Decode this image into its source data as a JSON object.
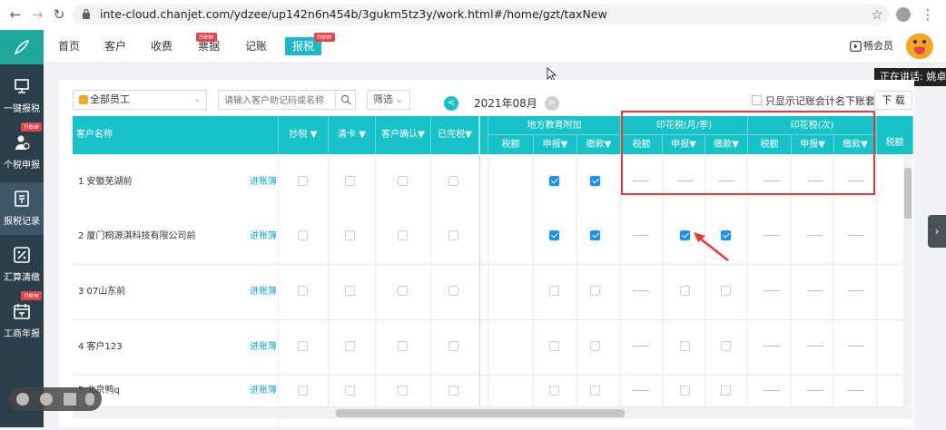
{
  "browser": {
    "url": "inte-cloud.chanjet.com/ydzee/up142n6n454b/3gukm5tz3y/work.html#/home/gzt/taxNew"
  },
  "sidebar": {
    "items": [
      {
        "label": "一键报税",
        "icon": "monitor-icon",
        "new": ""
      },
      {
        "label": "个税申报",
        "icon": "user-tax-icon",
        "new": "new"
      },
      {
        "label": "报税记录",
        "icon": "tax-record-icon",
        "new": ""
      },
      {
        "label": "汇算清缴",
        "icon": "percent-icon",
        "new": ""
      },
      {
        "label": "工商年报",
        "icon": "calendar-icon",
        "new": "new"
      }
    ]
  },
  "topnav": {
    "items": [
      {
        "label": "首页"
      },
      {
        "label": "客户"
      },
      {
        "label": "收费"
      },
      {
        "label": "票据",
        "new": "new"
      },
      {
        "label": "记账"
      },
      {
        "label": "报税",
        "new": "new"
      }
    ],
    "member_label": "畅会员"
  },
  "overlay": {
    "speaking": "正在讲话: 姚卓"
  },
  "toolbar": {
    "employee": "全部员工",
    "search_placeholder": "请输入客户助记码或名称",
    "filter": "筛选",
    "prev": "<",
    "month": "2021年08月",
    "next": ">",
    "show_accountant": "只显示记账会计名下账套",
    "download": "下 载"
  },
  "table": {
    "headers": {
      "customer": "客户名称",
      "copy_tax": "抄税",
      "clear_card": "清卡",
      "customer_confirm": "客户确认",
      "finished": "已完税"
    },
    "groups": [
      {
        "title": "地方教育附加",
        "subs": [
          "税额",
          "申报",
          "缴款"
        ]
      },
      {
        "title": "印花税(月/季)",
        "subs": [
          "税额",
          "申报",
          "缴款"
        ]
      },
      {
        "title": "印花税(次)",
        "subs": [
          "税额",
          "申报",
          "缴款"
        ]
      }
    ],
    "extra_col": "税额",
    "ledger_link": "进账簿",
    "dash": "——",
    "rows": [
      {
        "name": "1 安徽芜湖前",
        "local_declare": true,
        "local_pay": true,
        "stamp_declare": null,
        "stamp_pay": null
      },
      {
        "name": "2 厦门桐源淇科技有限公司前",
        "local_declare": true,
        "local_pay": true,
        "stamp_declare": true,
        "stamp_pay": true
      },
      {
        "name": "3 07山东前",
        "local_declare": false,
        "local_pay": false,
        "stamp_declare": false,
        "stamp_pay": false
      },
      {
        "name": "4 客户123",
        "local_declare": false,
        "local_pay": false,
        "stamp_declare": false,
        "stamp_pay": false
      },
      {
        "name": "5 北京鸭q",
        "local_declare": false,
        "local_pay": false,
        "stamp_declare": false,
        "stamp_pay": false
      }
    ]
  },
  "colors": {
    "header_teal": "#17c2c9",
    "sidebar_dark": "#2a3f4a",
    "checkbox_blue": "#1890ff",
    "annotation_red": "#e23a3a"
  }
}
